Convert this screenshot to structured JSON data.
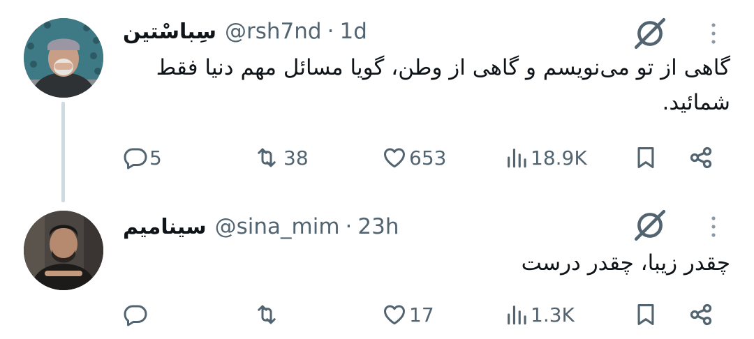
{
  "tweets": [
    {
      "display_name": "سِباسْتین",
      "handle": "@rsh7nd",
      "separator": "·",
      "time": "1d",
      "text": "گاهی از تو می‌نویسم و گاهی از وطن، گویا مسائل مهم دنیا فقط شمائید.",
      "replies": "5",
      "retweets": "38",
      "likes": "653",
      "views": "18.9K"
    },
    {
      "display_name": "سینامیم",
      "handle": "@sina_mim",
      "separator": "·",
      "time": "23h",
      "text": "چقدر زیبا، چقدر درست",
      "replies": "",
      "retweets": "",
      "likes": "17",
      "views": "1.3K"
    }
  ],
  "icons": {
    "reply": "reply-icon",
    "retweet": "retweet-icon",
    "like": "heart-icon",
    "views": "views-icon",
    "bookmark": "bookmark-icon",
    "share": "share-icon",
    "grok": "grok-icon",
    "more": "more-vertical-icon"
  },
  "colors": {
    "text": "#0f1419",
    "secondary": "#536471",
    "thread_line": "#cfd9de"
  }
}
